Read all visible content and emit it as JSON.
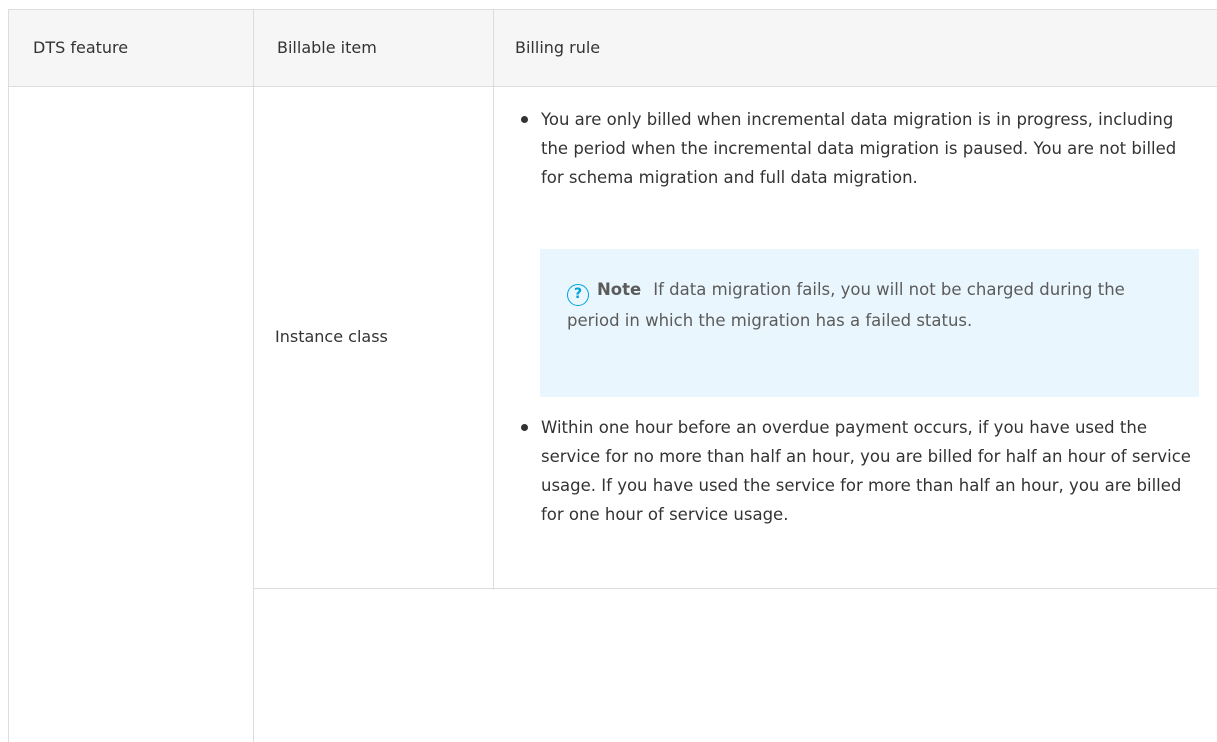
{
  "table": {
    "headers": {
      "feature": "DTS feature",
      "billable_item": "Billable item",
      "billing_rule": "Billing rule"
    },
    "rows": [
      {
        "billable_item": "Instance class",
        "rules": [
          "You are only billed when incremental data migration is in progress, including the period when the incremental data migration is paused. You are not billed for schema migration and full data migration.",
          "Within one hour before an overdue payment occurs, if you have used the service for no more than half an hour, you are billed for half an hour of service usage. If you have used the service for more than half an hour, you are billed for one hour of service usage."
        ],
        "note": {
          "icon": "help-circle-icon",
          "label": "Note",
          "text": "If data migration fails, you will not be charged during the period in which the migration has a failed status."
        }
      }
    ]
  },
  "colors": {
    "header_bg": "#f6f6f6",
    "border": "#dddddd",
    "note_bg": "#e9f6fd",
    "note_icon": "#00a3e0",
    "text": "#333333"
  }
}
